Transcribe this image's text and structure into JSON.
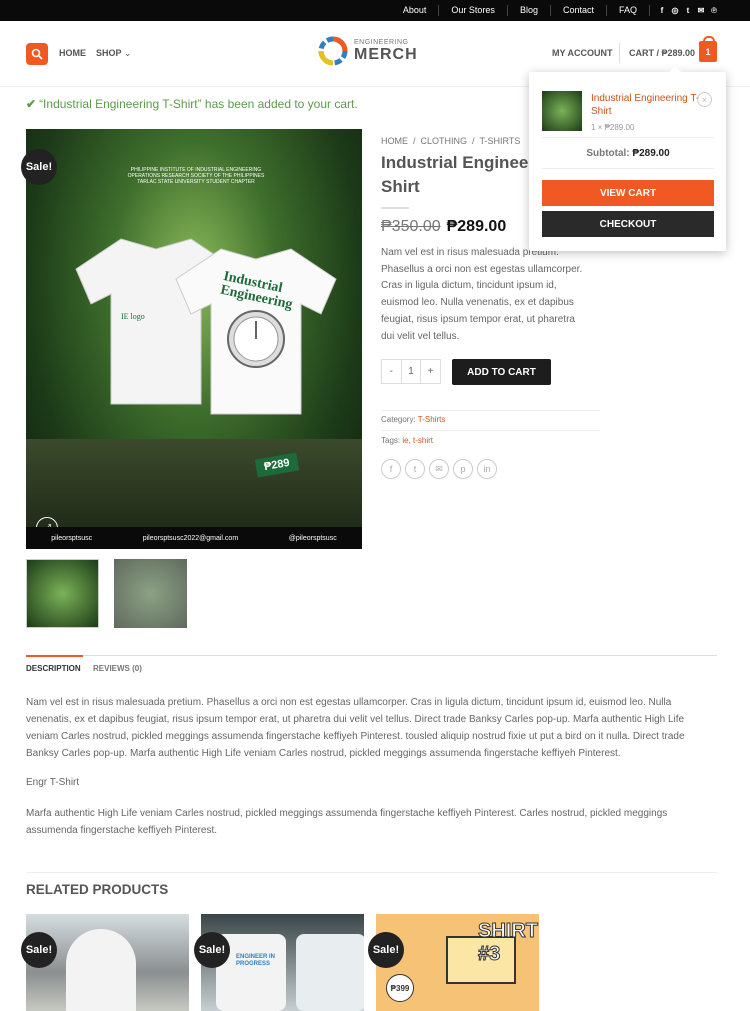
{
  "topbar": {
    "links": [
      "About",
      "Our Stores",
      "Blog",
      "Contact",
      "FAQ"
    ],
    "social_icons": [
      "facebook-icon",
      "instagram-icon",
      "twitter-icon",
      "email-icon",
      "pinterest-icon"
    ]
  },
  "header": {
    "nav": [
      "HOME",
      "SHOP"
    ],
    "logo_line1": "ENGINEERING",
    "logo_line2": "MERCH",
    "account": "MY ACCOUNT",
    "cart": "CART / ₱289.00",
    "cart_count": "1"
  },
  "notice": "“Industrial Engineering T-Shirt” has been added to your cart.",
  "product": {
    "breadcrumb": [
      "HOME",
      "CLOTHING",
      "T-SHIRTS"
    ],
    "title": "Industrial Engineering T-Shirt",
    "title_visible": "Industrial Engineer Shirt",
    "old_price": "₱350.00",
    "price": "₱289.00",
    "short_description": "Nam vel est in risus malesuada pretium. Phasellus a orci non est egestas ullamcorper. Cras in ligula dictum, tincidunt ipsum id, euismod leo. Nulla venenatis, ex et dapibus feugiat, risus ipsum tempor erat, ut pharetra dui velit vel tellus.",
    "qty": "1",
    "add_to_cart": "ADD TO CART",
    "category_label": "Category:",
    "category": "T-Shirts",
    "tags_label": "Tags:",
    "tags": "ie, t-shirt",
    "sale_badge": "Sale!",
    "image": {
      "header_text": "PHILIPPINE INSTITUTE OF INDUSTRIAL ENGINEERING OPERATIONS RESEARCH SOCIETY OF THE PHILIPPINES TARLAC STATE UNIVERSITY STUDENT CHAPTER",
      "shirt_text": "Industrial Engineering",
      "price_tag": "₱289",
      "footer": [
        "pileorsptsusc",
        "pileorsptsusc2022@gmail.com",
        "@pileorsptsusc"
      ]
    }
  },
  "tabs": [
    "DESCRIPTION",
    "REVIEWS (0)"
  ],
  "description": [
    "Nam vel est in risus malesuada pretium. Phasellus a orci non est egestas ullamcorper. Cras in ligula dictum, tincidunt ipsum id, euismod leo. Nulla venenatis, ex et dapibus feugiat, risus ipsum tempor erat, ut pharetra dui velit vel tellus. Direct trade Banksy Carles pop-up. Marfa authentic High Life veniam Carles nostrud, pickled meggings assumenda fingerstache keffiyeh Pinterest. tousled aliquip nostrud fixie ut put a bird on it nulla. Direct trade Banksy Carles pop-up. Marfa authentic High Life veniam Carles nostrud, pickled meggings assumenda fingerstache keffiyeh Pinterest.",
    "Engr T-Shirt",
    "Marfa authentic High Life veniam Carles nostrud, pickled meggings assumenda fingerstache keffiyeh Pinterest. Carles nostrud, pickled meggings assumenda fingerstache keffiyeh Pinterest."
  ],
  "related": {
    "heading": "RELATED PRODUCTS",
    "badge": "Sale!",
    "r2_text": "ENGINEER IN PROGRESS",
    "r3_text": "SHIRT #3",
    "r3_price": "₱399"
  },
  "minicart": {
    "item_name": "Industrial Engineering T-Shirt",
    "item_qty": "1 × ₱289.00",
    "subtotal_label": "Subtotal:",
    "subtotal": "₱289.00",
    "view_cart": "VIEW CART",
    "checkout": "CHECKOUT"
  },
  "colors": {
    "accent": "#f05a22",
    "dark": "#1d1d1d",
    "link": "#c9541c",
    "success": "#5b9b4c"
  }
}
